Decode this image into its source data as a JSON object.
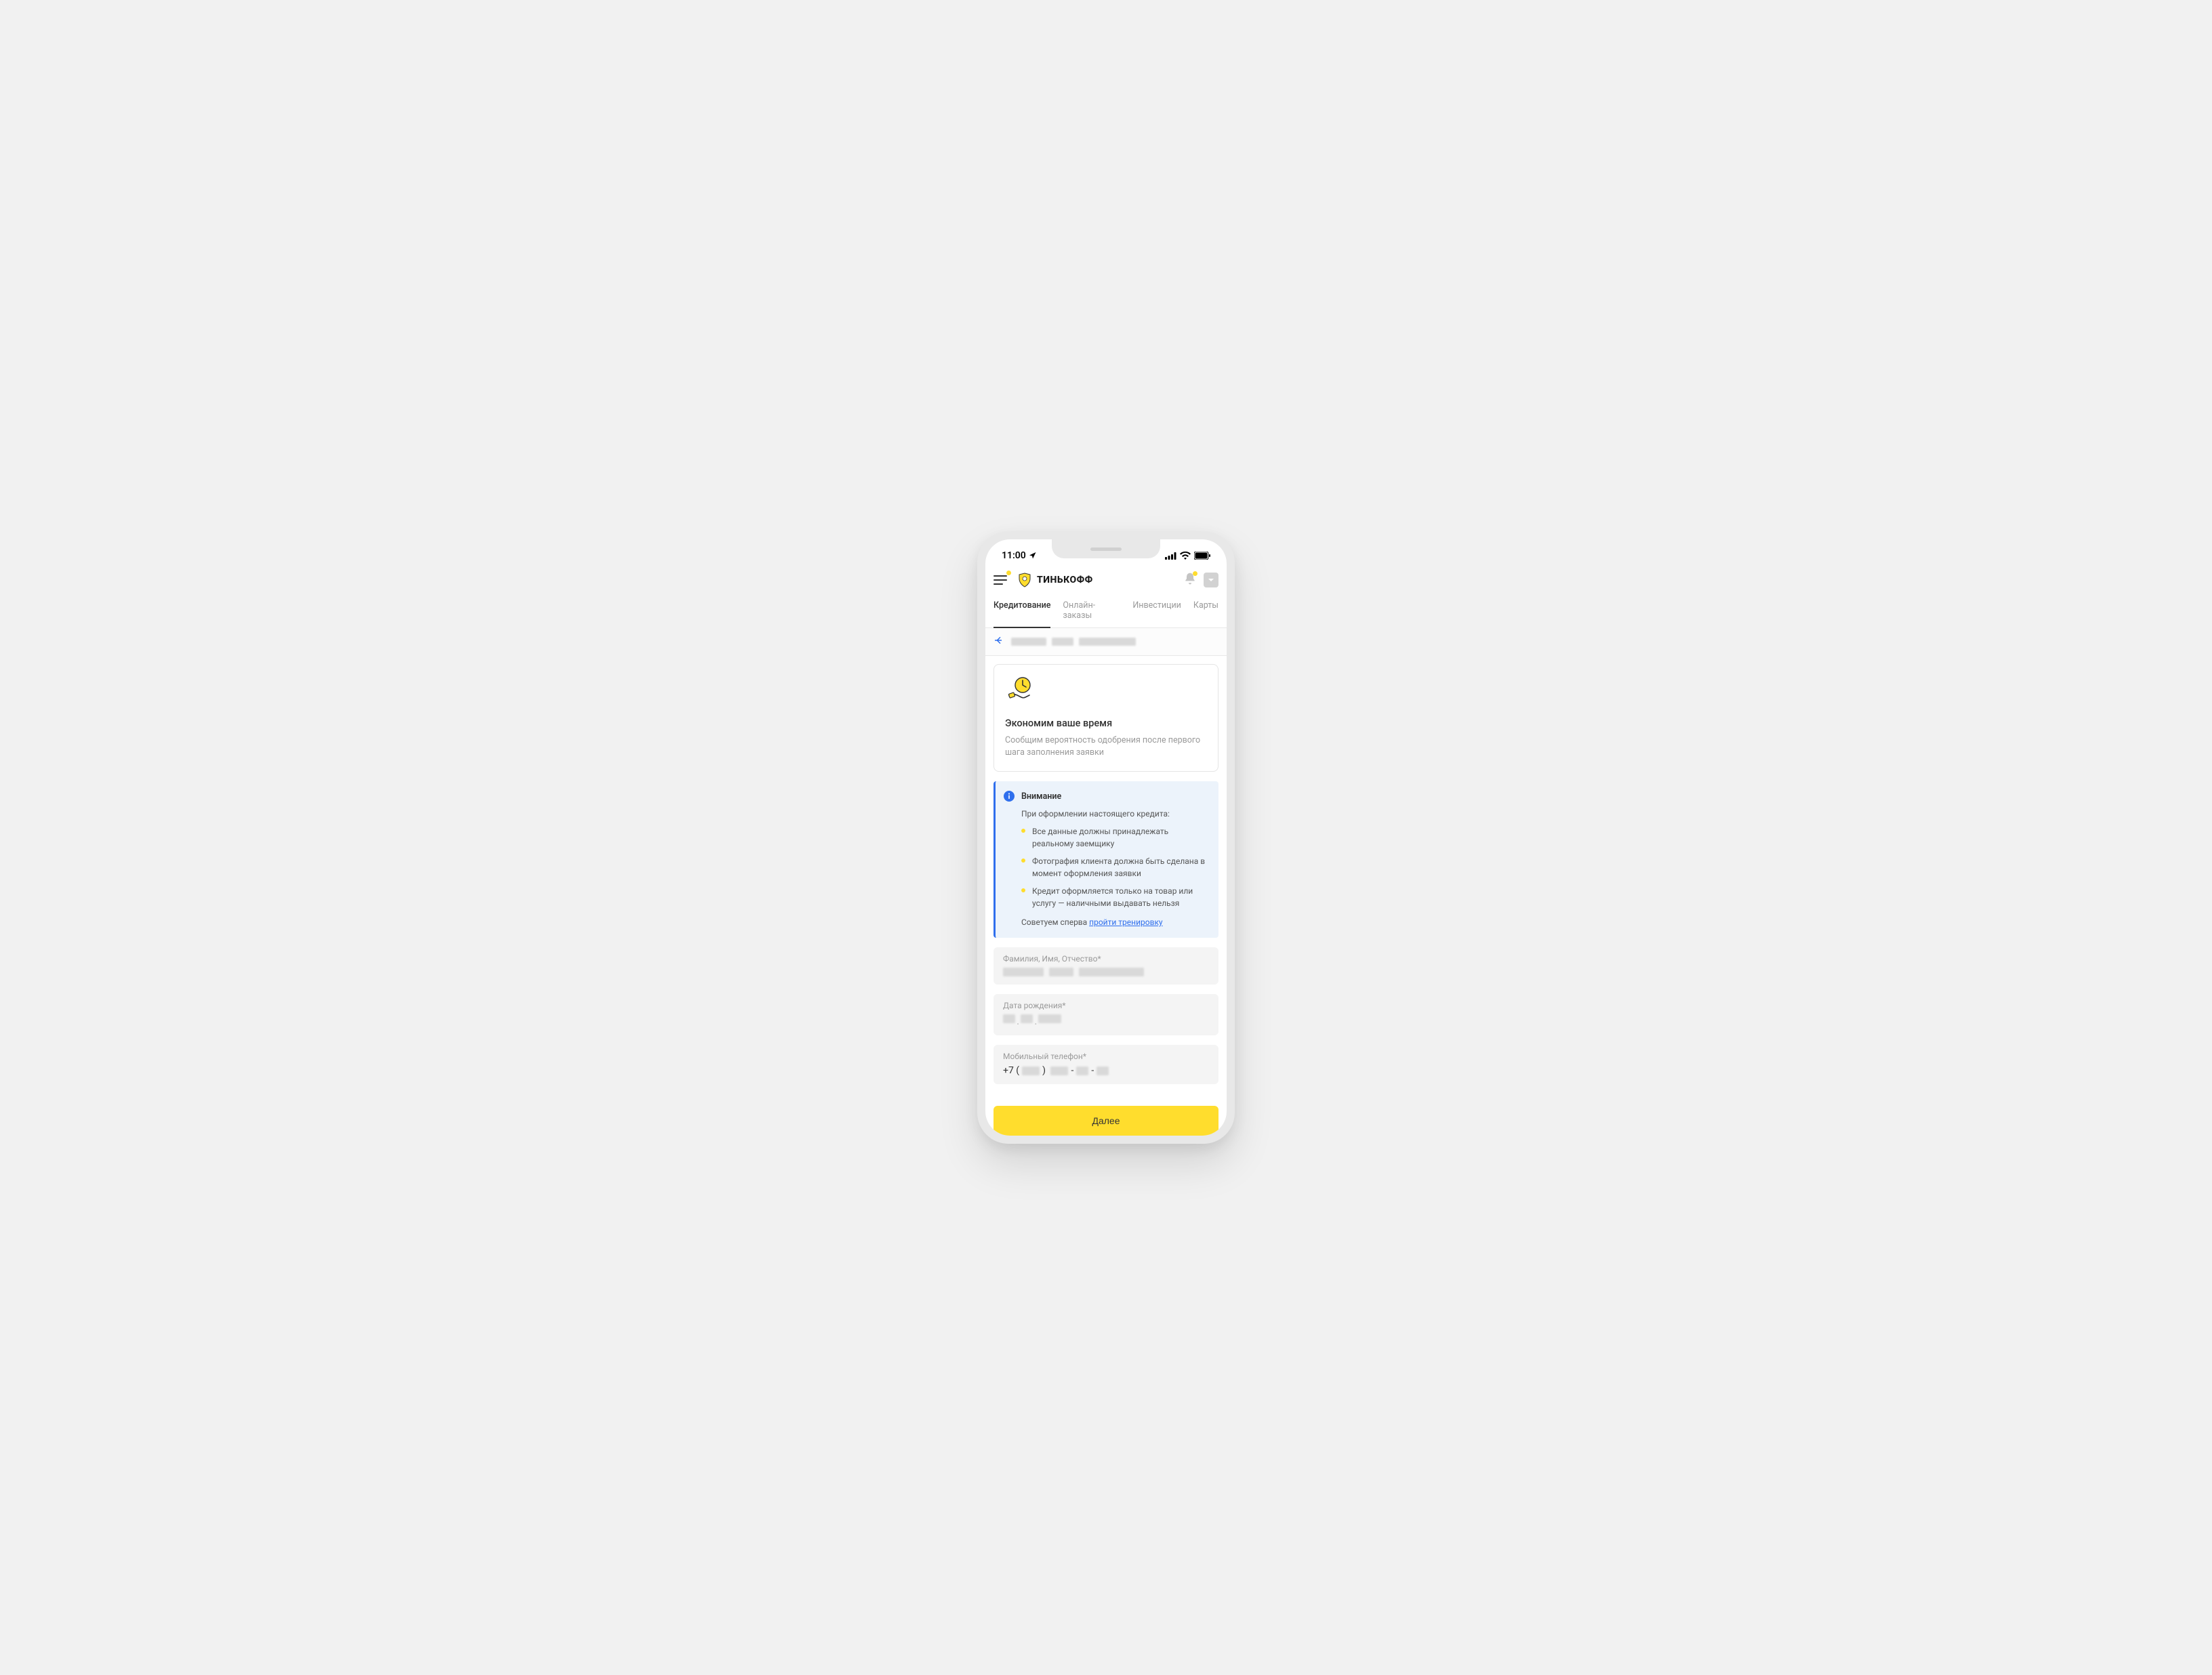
{
  "status": {
    "time": "11:00"
  },
  "header": {
    "brand": "ТИНЬКОФФ"
  },
  "tabs": [
    {
      "label": "Кредитование",
      "active": true
    },
    {
      "label": "Онлайн-заказы",
      "active": false
    },
    {
      "label": "Инвестиции",
      "active": false
    },
    {
      "label": "Карты",
      "active": false
    }
  ],
  "promo": {
    "title": "Экономим ваше время",
    "desc": "Сообщим вероятность одобрения после первого шага заполнения заявки"
  },
  "alert": {
    "title": "Внимание",
    "intro": "При оформлении настоящего кредита:",
    "items": [
      "Все данные должны принадлежать реальному заемщику",
      "Фотография клиента должна быть сделана в момент оформления заявки",
      "Кредит оформляется только на товар или услугу — наличными выдавать нельзя"
    ],
    "advice_prefix": "Советуем сперва ",
    "advice_link": "пройти тренировку"
  },
  "fields": {
    "fio_label": "Фамилия, Имя, Отчество*",
    "dob_label": "Дата рождения*",
    "phone_label": "Мобильный телефон*",
    "phone_prefix": "+7 ("
  },
  "cta": {
    "label": "Далее"
  }
}
